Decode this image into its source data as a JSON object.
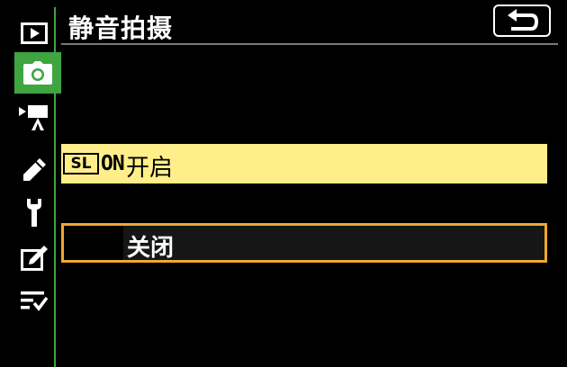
{
  "header": {
    "title": "静音拍摄",
    "back_icon": "return-arrow-icon"
  },
  "sidebar": {
    "items": [
      {
        "icon": "playback-icon",
        "active": false
      },
      {
        "icon": "camera-icon",
        "active": true
      },
      {
        "icon": "movie-camera-icon",
        "active": false
      },
      {
        "icon": "pencil-icon",
        "active": false
      },
      {
        "icon": "wrench-icon",
        "active": false
      },
      {
        "icon": "retouch-icon",
        "active": false
      },
      {
        "icon": "my-menu-icon",
        "active": false
      }
    ]
  },
  "options": [
    {
      "badge": "SL",
      "badge_text": "ON",
      "label": "开启",
      "selected": true
    },
    {
      "badge": "",
      "badge_text": "",
      "label": "关闭",
      "selected": false
    }
  ],
  "colors": {
    "accent_green": "#3ea540",
    "highlight": "#ffee8a",
    "focus_border": "#f0a830"
  }
}
